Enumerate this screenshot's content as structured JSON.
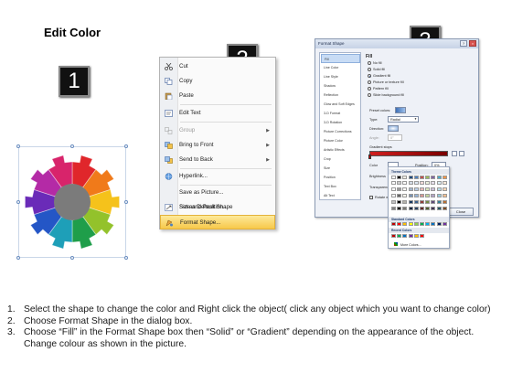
{
  "title": "Edit Color",
  "step_badges": [
    "1",
    "2",
    "3"
  ],
  "gear_colors": [
    "#e0262b",
    "#f07a1a",
    "#f5c21b",
    "#93c22b",
    "#1f9e4a",
    "#1e9fb8",
    "#2456c6",
    "#6a2bb8",
    "#b42aa6",
    "#d8246b"
  ],
  "context_menu": {
    "items": [
      {
        "label": "Cut",
        "icon": "scissors-icon",
        "disabled": false,
        "submenu": false
      },
      {
        "label": "Copy",
        "icon": "copy-icon",
        "disabled": false,
        "submenu": false
      },
      {
        "label": "Paste",
        "icon": "paste-icon",
        "disabled": false,
        "submenu": false
      },
      {
        "label": "Edit Text",
        "icon": "edit-text-icon",
        "disabled": false,
        "submenu": false
      },
      {
        "label": "Group",
        "icon": "group-icon",
        "disabled": true,
        "submenu": true
      },
      {
        "label": "Bring to Front",
        "icon": "bring-front-icon",
        "disabled": false,
        "submenu": true
      },
      {
        "label": "Send to Back",
        "icon": "send-back-icon",
        "disabled": false,
        "submenu": true
      },
      {
        "label": "Hyperlink...",
        "icon": "hyperlink-icon",
        "disabled": false,
        "submenu": false
      },
      {
        "label": "Save as Picture...",
        "icon": "",
        "disabled": false,
        "submenu": false
      },
      {
        "label": "Set as Default Shape",
        "icon": "",
        "disabled": false,
        "submenu": false
      },
      {
        "label": "Size and Position...",
        "icon": "size-icon",
        "disabled": false,
        "submenu": false
      },
      {
        "label": "Format Shape...",
        "icon": "format-shape-icon",
        "disabled": false,
        "submenu": false,
        "highlighted": true
      }
    ]
  },
  "format_dialog": {
    "title": "Format Shape",
    "nav_items": [
      "Fill",
      "Line Color",
      "Line Style",
      "Shadow",
      "Reflection",
      "Glow and Soft Edges",
      "3-D Format",
      "3-D Rotation",
      "Picture Corrections",
      "Picture Color",
      "Artistic Effects",
      "Crop",
      "Size",
      "Position",
      "Text Box",
      "Alt Text"
    ],
    "section": "Fill",
    "fill_options": [
      "No fill",
      "Solid fill",
      "Gradient fill",
      "Picture or texture fill",
      "Pattern fill",
      "Slide background fill"
    ],
    "selected_fill": "Gradient fill",
    "preset_colors_label": "Preset colors:",
    "type_label": "Type:",
    "type_value": "Radial",
    "direction_label": "Direction:",
    "angle_label": "Angle:",
    "angle_value": "0°",
    "gradient_stops_label": "Gradient stops",
    "color_label": "Color",
    "position_label": "Position:",
    "position_value": "0%",
    "brightness_label": "Brightness",
    "transparency_label": "Transparency",
    "rotate_label": "Rotate with shape",
    "close_label": "Close"
  },
  "palette": {
    "theme_label": "Theme Colors",
    "standard_label": "Standard Colors",
    "recent_label": "Recent Colors",
    "more_label": "More Colors...",
    "theme_row": [
      "#ffffff",
      "#000000",
      "#eeece1",
      "#1f497d",
      "#4f81bd",
      "#c0504d",
      "#9bbb59",
      "#8064a2",
      "#4bacc6",
      "#f79646"
    ],
    "standard_row": [
      "#c00000",
      "#ff0000",
      "#ffc000",
      "#ffff00",
      "#92d050",
      "#00b050",
      "#00b0f0",
      "#0070c0",
      "#002060",
      "#7030a0"
    ],
    "recent_row": [
      "#c00000",
      "#00b050",
      "#0070c0",
      "#7030a0",
      "#ffc000",
      "#ff0000"
    ]
  },
  "instructions": [
    {
      "num": "1.",
      "text": "Select the shape to change the color and Right click the object( click any object which you want to change color)"
    },
    {
      "num": "2.",
      "text": "Choose Format Shape in the dialog box."
    },
    {
      "num": "3.",
      "text": "Choose “Fill” in the Format Shape box then “Solid” or “Gradient” depending on the appearance of the object. Change colour as shown in the picture."
    }
  ]
}
